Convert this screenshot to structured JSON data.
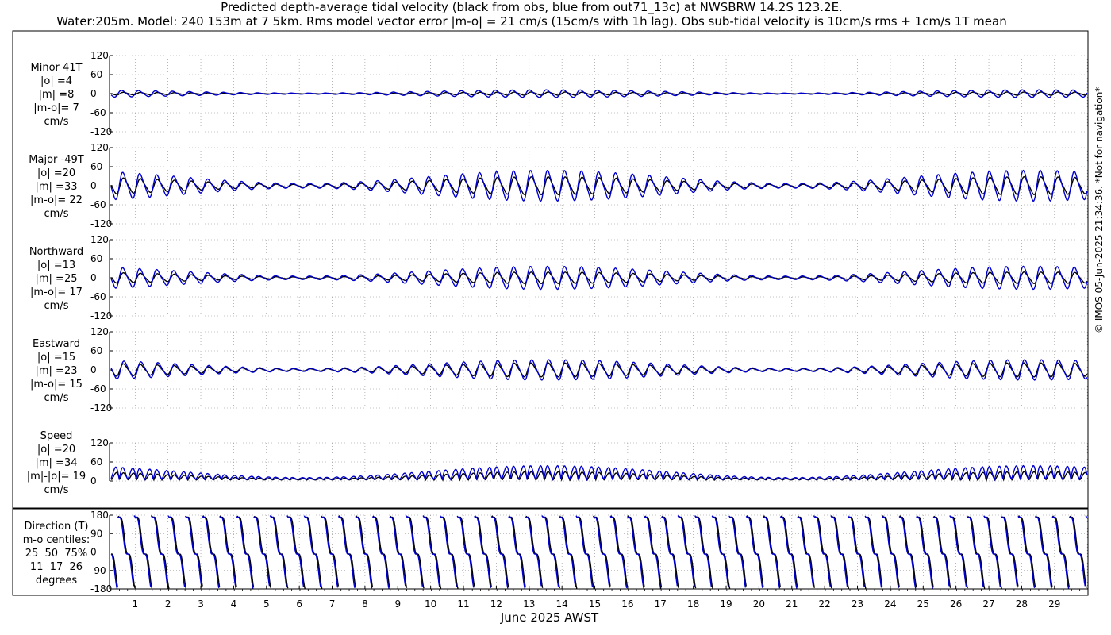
{
  "title_line1": "Predicted depth-average tidal velocity (black from obs, blue from out71_13c) at NWSBRW 14.2S 123.2E.",
  "title_line2": "Water:205m. Model: 240 153m at 7 5km. Rms model vector error |m-o| = 21 cm/s (15cm/s with 1h lag). Obs sub-tidal velocity is 10cm/s rms + 1cm/s 1T mean",
  "footer": "© IMOS 05-Jun-2025 21:34:36. *Not for navigation*",
  "colors": {
    "obs": "#000000",
    "model": "#0000cc"
  },
  "chart_data": {
    "type": "line",
    "xlabel": "June 2025 AWST",
    "x_ticks": [
      "1",
      "2",
      "3",
      "4",
      "5",
      "6",
      "7",
      "8",
      "9",
      "10",
      "11",
      "12",
      "13",
      "14",
      "15",
      "16",
      "17",
      "18",
      "19",
      "20",
      "21",
      "22",
      "23",
      "24",
      "25",
      "26",
      "27",
      "28",
      "29"
    ],
    "x_range_days": [
      0.2,
      30.0
    ],
    "grid": true,
    "series_legend": [
      {
        "name": "obs",
        "color": "#000000"
      },
      {
        "name": "model (out71_13c)",
        "color": "#0000cc"
      }
    ],
    "panels": [
      {
        "id": "minor",
        "label_lines": [
          "Minor 41T",
          "|o| =4",
          "|m| =8",
          "|m-o|= 7",
          "cm/s"
        ],
        "ylim": [
          -120,
          120
        ],
        "yticks": [
          {
            "v": 120,
            "t": "120"
          },
          {
            "v": 60,
            "t": "60"
          },
          {
            "v": 0,
            "t": "0"
          },
          {
            "v": -60,
            "t": "-60"
          },
          {
            "v": -120,
            "t": "-120"
          }
        ],
        "obs_amp": 5,
        "model_amp": 12,
        "kind": "vel",
        "phase_lag": 0.7
      },
      {
        "id": "major",
        "label_lines": [
          "Major -49T",
          "|o| =20",
          "|m| =33",
          "|m-o|= 22",
          "cm/s"
        ],
        "ylim": [
          -120,
          120
        ],
        "yticks": [
          {
            "v": 120,
            "t": "120"
          },
          {
            "v": 60,
            "t": "60"
          },
          {
            "v": 0,
            "t": "0"
          },
          {
            "v": -60,
            "t": "-60"
          },
          {
            "v": -120,
            "t": "-120"
          }
        ],
        "obs_amp": 28,
        "model_amp": 48,
        "kind": "vel",
        "phase_lag": 0.25
      },
      {
        "id": "north",
        "label_lines": [
          "Northward",
          "|o| =13",
          "|m| =25",
          "|m-o|= 17",
          "cm/s"
        ],
        "ylim": [
          -120,
          120
        ],
        "yticks": [
          {
            "v": 120,
            "t": "120"
          },
          {
            "v": 60,
            "t": "60"
          },
          {
            "v": 0,
            "t": "0"
          },
          {
            "v": -60,
            "t": "-60"
          },
          {
            "v": -120,
            "t": "-120"
          }
        ],
        "obs_amp": 18,
        "model_amp": 36,
        "kind": "vel",
        "phase_lag": 0.25
      },
      {
        "id": "east",
        "label_lines": [
          "Eastward",
          "|o| =15",
          "|m| =23",
          "|m-o|= 15",
          "cm/s"
        ],
        "ylim": [
          -120,
          120
        ],
        "yticks": [
          {
            "v": 120,
            "t": "120"
          },
          {
            "v": 60,
            "t": "60"
          },
          {
            "v": 0,
            "t": "0"
          },
          {
            "v": -60,
            "t": "-60"
          },
          {
            "v": -120,
            "t": "-120"
          }
        ],
        "obs_amp": 22,
        "model_amp": 32,
        "kind": "vel",
        "phase_lag": -0.2
      },
      {
        "id": "speed",
        "label_lines": [
          "Speed",
          "|o| =20",
          "|m| =34",
          "|m|-|o|= 19",
          "cm/s"
        ],
        "ylim": [
          0,
          120
        ],
        "yticks": [
          {
            "v": 120,
            "t": "120"
          },
          {
            "v": 60,
            "t": "60"
          },
          {
            "v": 0,
            "t": "0"
          }
        ],
        "obs_amp": 26,
        "model_amp": 44,
        "kind": "speed",
        "phase_lag": 0.25
      },
      {
        "id": "direction",
        "label_lines": [
          "Direction (T)",
          "m-o centiles:",
          "25  50  75%",
          "11  17  26",
          "degrees"
        ],
        "ylim": [
          -180,
          180
        ],
        "yticks": [
          {
            "v": 180,
            "t": "180"
          },
          {
            "v": 90,
            "t": "90"
          },
          {
            "v": 0,
            "t": "0"
          },
          {
            "v": -90,
            "t": "-90"
          },
          {
            "v": -180,
            "t": "-180"
          }
        ],
        "kind": "dir",
        "phase_lag": 0.35
      }
    ]
  }
}
